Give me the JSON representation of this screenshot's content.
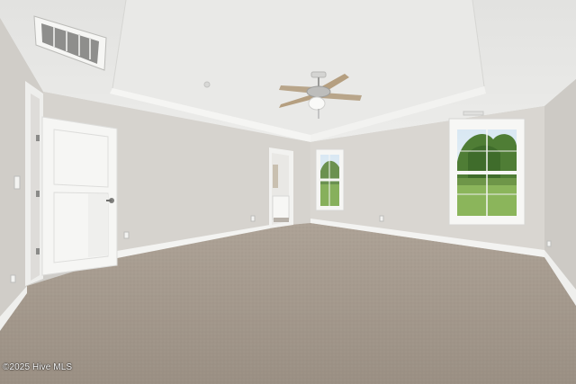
{
  "watermark": "©2025 Hive MLS",
  "colors": {
    "wall": "#d7d4cf",
    "wall_shadow": "#c8c5c0",
    "ceiling": "#e6e6e4",
    "trim": "#f4f4f2",
    "carpet": "#a59a8d",
    "door": "#f6f6f4",
    "window_glass_sky": "#cfe2ef",
    "window_foliage": "#5c8a3c"
  },
  "icons": [
    "ceiling-fan-icon",
    "air-vent-icon",
    "door-handle-icon"
  ]
}
